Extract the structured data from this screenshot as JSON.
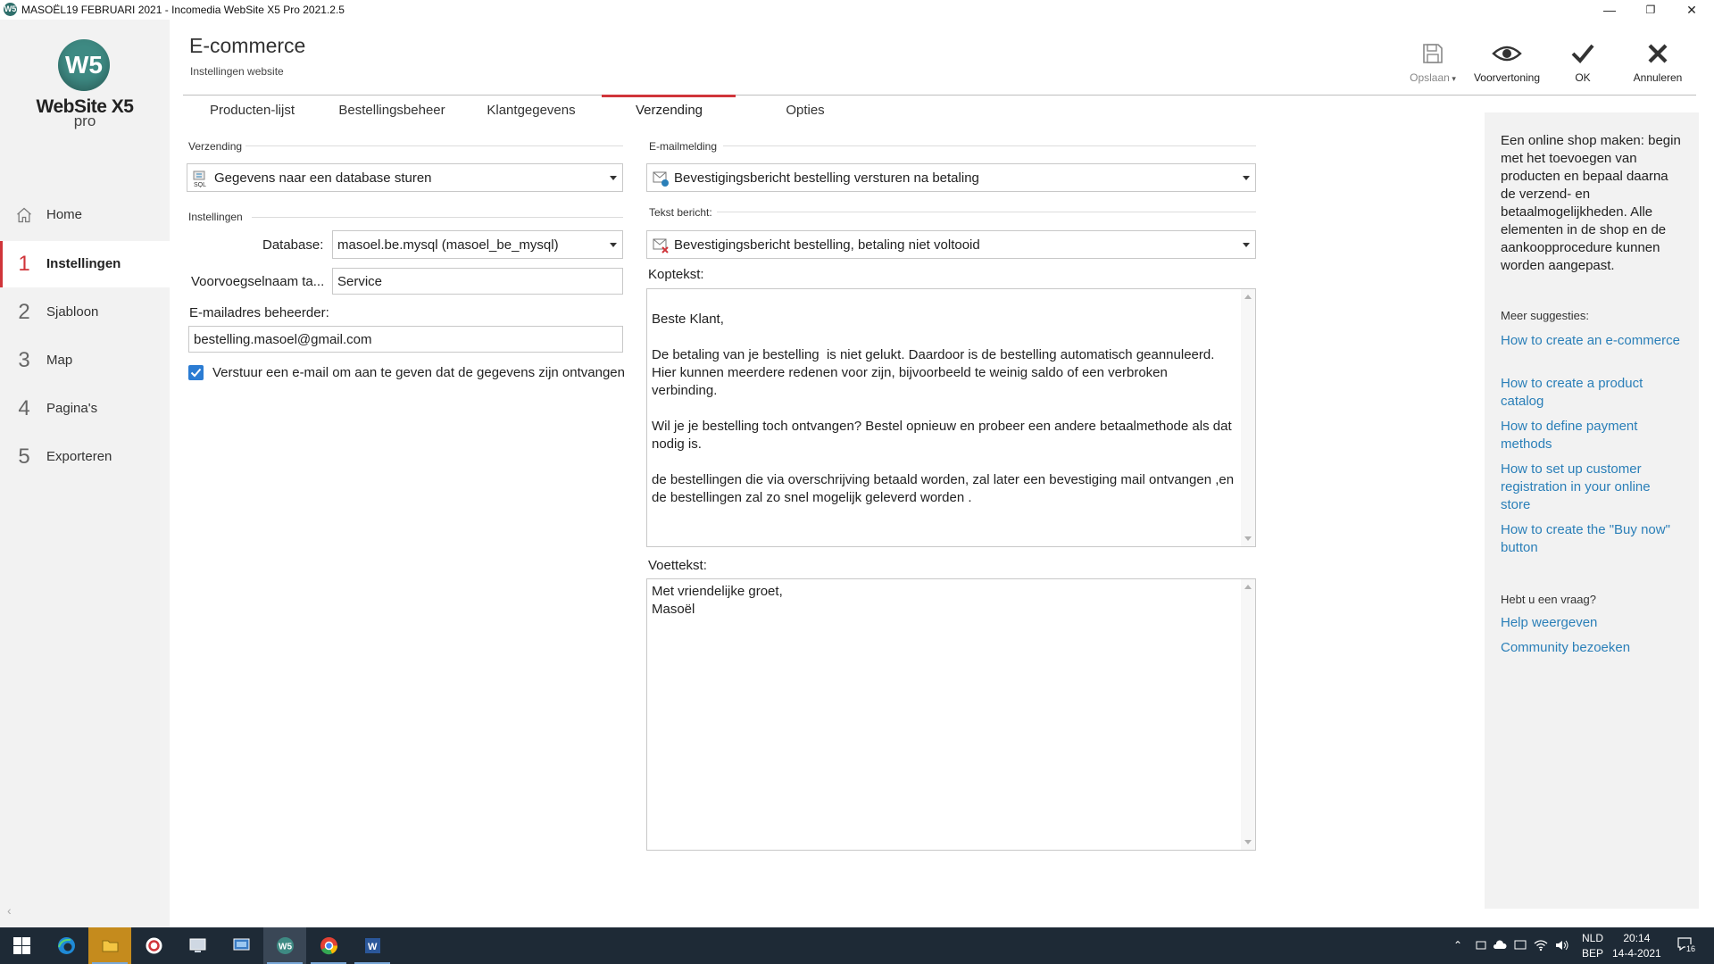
{
  "window": {
    "title": "MASOËL19 FEBRUARI 2021 - Incomedia WebSite X5 Pro 2021.2.5",
    "controls": [
      "—",
      "❐",
      "✕"
    ]
  },
  "sidebar": {
    "logo_mark": "W5",
    "logo_word": "WebSite X5",
    "logo_edition": "pro",
    "collapse_glyph": "‹",
    "items": [
      {
        "num": "",
        "label": "Home",
        "icon": "home-icon"
      },
      {
        "num": "1",
        "label": "Instellingen"
      },
      {
        "num": "2",
        "label": "Sjabloon"
      },
      {
        "num": "3",
        "label": "Map"
      },
      {
        "num": "4",
        "label": "Pagina's"
      },
      {
        "num": "5",
        "label": "Exporteren"
      }
    ]
  },
  "header": {
    "title": "E-commerce",
    "subtitle": "Instellingen website",
    "buttons": {
      "save": "Opslaan",
      "preview": "Voorvertoning",
      "ok": "OK",
      "cancel": "Annuleren"
    }
  },
  "tabs": [
    "Producten-lijst",
    "Bestellingsbeheer",
    "Klantgegevens",
    "Verzending",
    "Opties"
  ],
  "active_tab": "Verzending",
  "left": {
    "section_title": "Verzending",
    "send_mode": "Gegevens naar een database sturen",
    "settings_title": "Instellingen",
    "database_label": "Database:",
    "database_value": "masoel.be.mysql (masoel_be_mysql)",
    "prefix_label": "Voorvoegselnaam ta...",
    "prefix_value": "Service",
    "admin_email_label": "E-mailadres beheerder:",
    "admin_email_value": "bestelling.masoel@gmail.com",
    "checkbox_label": "Verstuur een e-mail om aan te geven dat de gegevens zijn ontvangen",
    "checkbox_checked": true
  },
  "right": {
    "email_section_title": "E-mailmelding",
    "email_mode": "Bevestigingsbericht bestelling versturen na betaling",
    "text_message_title": "Tekst bericht:",
    "text_message": "Bevestigingsbericht bestelling, betaling niet voltooid",
    "header_label": "Koptekst:",
    "header_text": "\nBeste Klant,\n\nDe betaling van je bestelling  is niet gelukt. Daardoor is de bestelling automatisch geannuleerd. Hier kunnen meerdere redenen voor zijn, bijvoorbeeld te weinig saldo of een verbroken verbinding.\n\nWil je je bestelling toch ontvangen? Bestel opnieuw en probeer een andere betaalmethode als dat nodig is.\n\nde bestellingen die via overschrijving betaald worden, zal later een bevestiging mail ontvangen ,en de bestellingen zal zo snel mogelijk geleverd worden .",
    "footer_label": "Voettekst:",
    "footer_text": "Met vriendelijke groet,\nMasoël"
  },
  "help": {
    "intro": "Een online shop maken: begin met het toevoegen van producten en bepaal daarna de verzend- en betaalmogelijkheden. Alle elementen in de shop en de aankoopprocedure kunnen worden aangepast.",
    "suggestions_title": "Meer suggesties:",
    "links": [
      "How to create an e-commerce",
      "How to create a product catalog",
      "How to define payment methods",
      "How to set up customer registration in your online store",
      "How to create the \"Buy now\" button"
    ],
    "question_title": "Hebt u een vraag?",
    "help_links": [
      "Help weergeven",
      "Community bezoeken"
    ]
  },
  "taskbar": {
    "lang_line1": "NLD",
    "lang_line2": "BEP",
    "time": "20:14",
    "date": "14-4-2021",
    "notifications": "16"
  },
  "colors": {
    "accent": "#d0353a",
    "link": "#2a7fb8",
    "sidebar_bg": "#f2f2f2",
    "taskbar_bg": "#1e2a36"
  }
}
